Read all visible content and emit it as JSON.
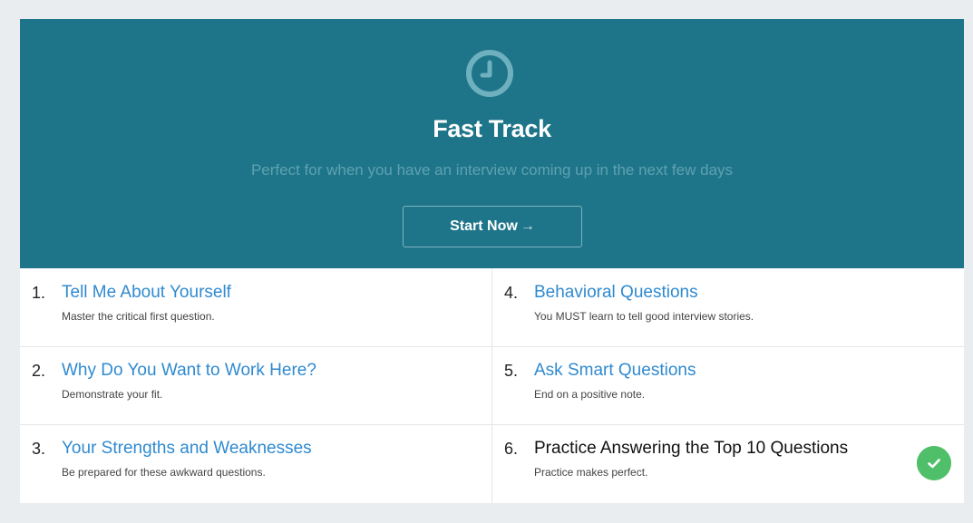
{
  "hero": {
    "icon": "clock-icon",
    "title": "Fast Track",
    "subtitle": "Perfect for when you have an interview coming up in the next few days",
    "start_label": "Start Now",
    "start_arrow": "→",
    "bg_color": "#1e7589"
  },
  "modules": [
    {
      "number": "1.",
      "title": "Tell Me About Yourself",
      "description": "Master the critical first question.",
      "completed": false
    },
    {
      "number": "2.",
      "title": "Why Do You Want to Work Here?",
      "description": "Demonstrate your fit.",
      "completed": false
    },
    {
      "number": "3.",
      "title": "Your Strengths and Weaknesses",
      "description": "Be prepared for these awkward questions.",
      "completed": false
    },
    {
      "number": "4.",
      "title": "Behavioral Questions",
      "description": "You MUST learn to tell good interview stories.",
      "completed": false
    },
    {
      "number": "5.",
      "title": "Ask Smart Questions",
      "description": "End on a positive note.",
      "completed": false
    },
    {
      "number": "6.",
      "title": "Practice Answering the Top 10 Questions",
      "description": "Practice makes perfect.",
      "completed": true
    }
  ],
  "colors": {
    "link": "#2f8ad0",
    "check": "#4fc069"
  }
}
